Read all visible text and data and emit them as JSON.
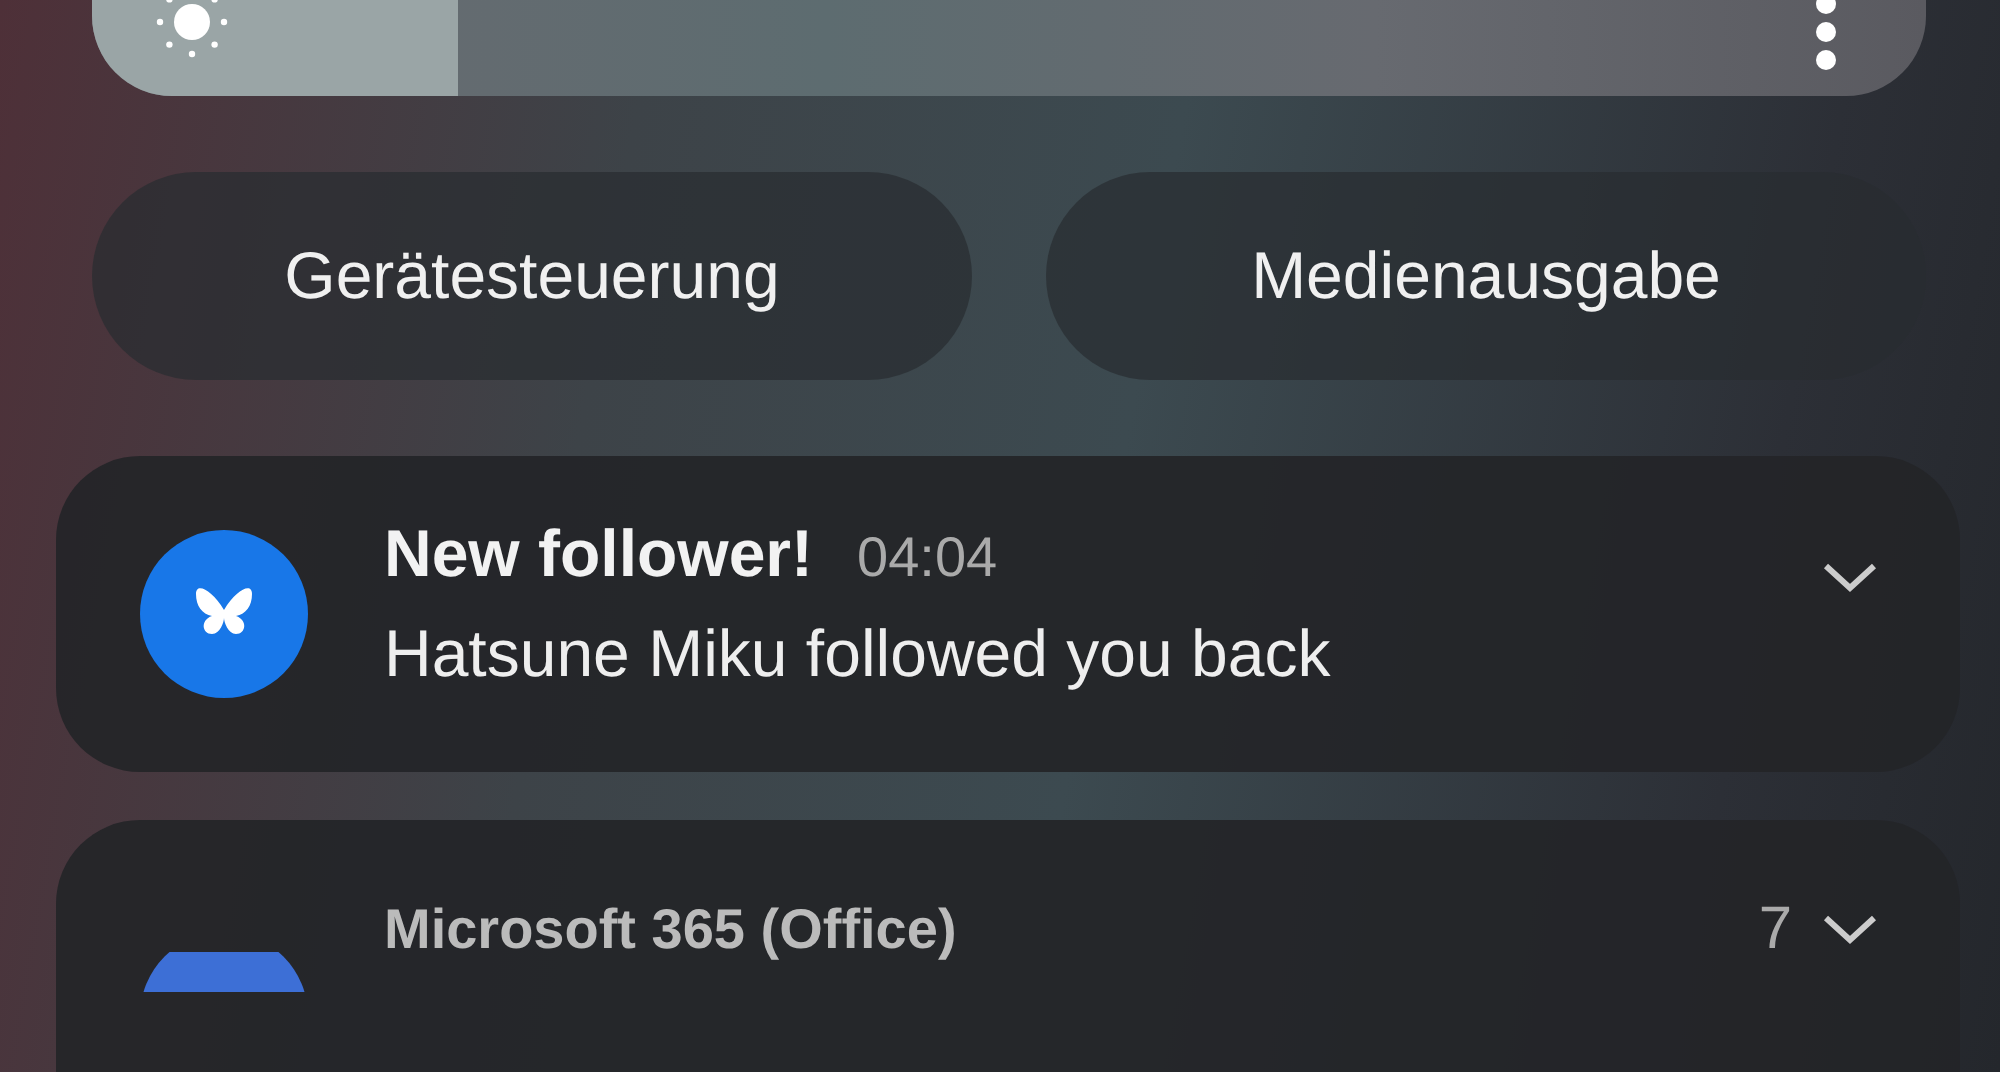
{
  "brightness": {
    "level": 0.2
  },
  "quick_buttons": [
    {
      "label": "Gerätesteuerung"
    },
    {
      "label": "Medienausgabe"
    }
  ],
  "notifications": [
    {
      "title": "New follower!",
      "time": "04:04",
      "body": "Hatsune Miku followed you back",
      "expanded": false
    },
    {
      "app": "Microsoft 365 (Office)",
      "count": "7",
      "expanded": false
    }
  ]
}
